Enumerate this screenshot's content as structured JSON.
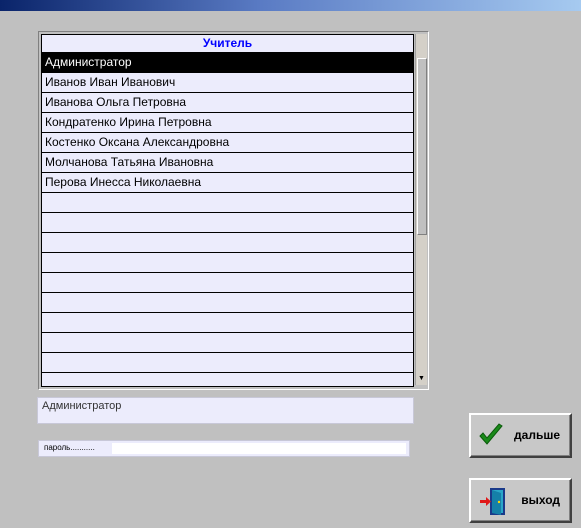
{
  "list": {
    "header": "Учитель",
    "items": [
      "Администратор",
      "Иванов Иван Иванович",
      "Иванова Ольга Петровна",
      "Кондратенко Ирина Петровна",
      "Костенко Оксана Александровна",
      "Молчанова Татьяна Ивановна",
      "Перова Инесса Николаевна",
      "",
      "",
      "",
      "",
      "",
      "",
      "",
      "",
      "",
      ""
    ],
    "selected_index": 0
  },
  "selected_name": "Администратор",
  "password": {
    "label": "пароль...........",
    "value": ""
  },
  "buttons": {
    "next": "дальше",
    "exit": "выход"
  },
  "colors": {
    "header_text": "#0000ff",
    "list_bg": "#ececfc",
    "selected_bg": "#000000",
    "check_green": "#1a8a1a"
  }
}
